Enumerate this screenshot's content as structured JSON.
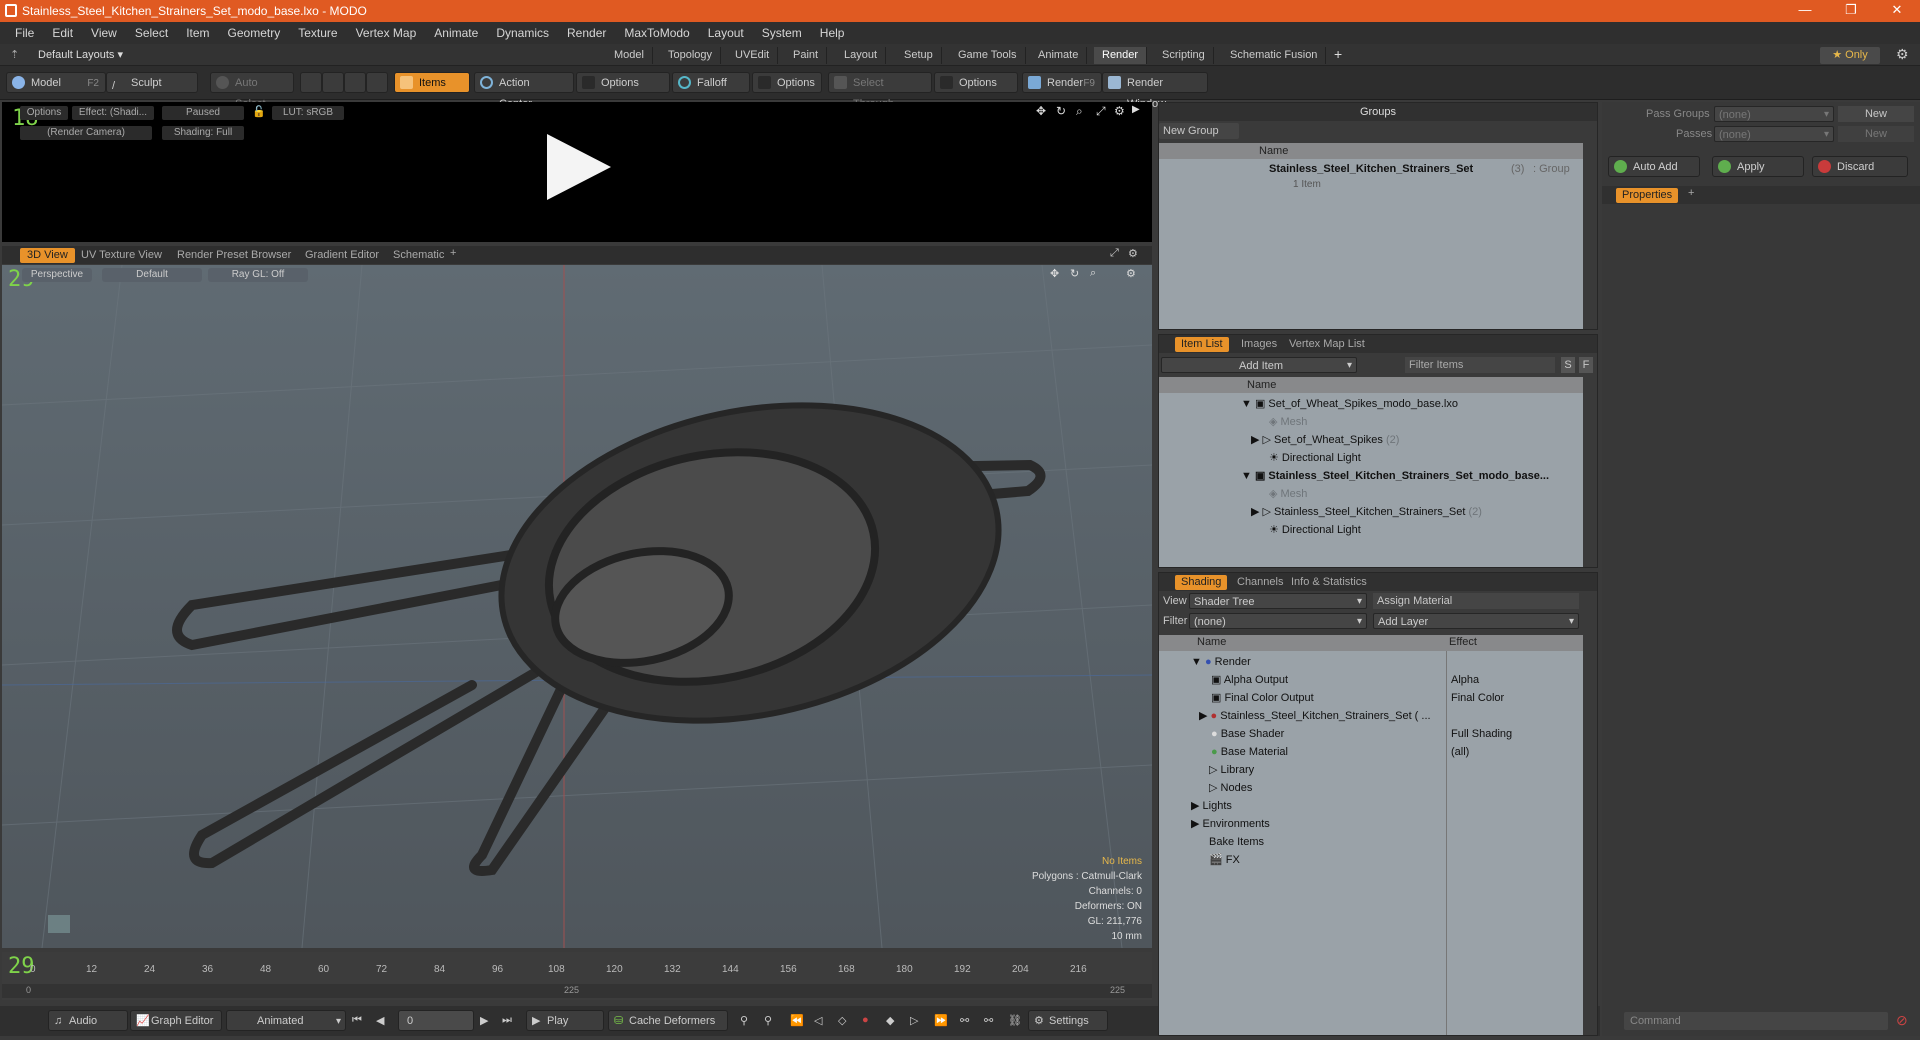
{
  "window": {
    "title": "Stainless_Steel_Kitchen_Strainers_Set_modo_base.lxo - MODO",
    "min": "—",
    "restore": "❐",
    "close": "✕"
  },
  "menu": [
    "File",
    "Edit",
    "View",
    "Select",
    "Item",
    "Geometry",
    "Texture",
    "Vertex Map",
    "Animate",
    "Dynamics",
    "Render",
    "MaxToModo",
    "Layout",
    "System",
    "Help"
  ],
  "layouts": {
    "label": "Default Layouts ▾",
    "tabs": [
      "Model",
      "Topology",
      "UVEdit",
      "Paint",
      "Layout",
      "Setup",
      "Game Tools",
      "Animate",
      "Render",
      "Scripting",
      "Schematic Fusion"
    ],
    "active": "Render",
    "plus": "+",
    "only": "★ Only"
  },
  "toolbar": {
    "model": "Model",
    "model_key": "F2",
    "sculpt": "Sculpt",
    "auto_select": "Auto Select",
    "items": "Items",
    "action_center": "Action Center",
    "options1": "Options",
    "falloff": "Falloff",
    "options2": "Options",
    "select_through": "Select Through",
    "options3": "Options",
    "render": "Render",
    "render_key": "F9",
    "render_window": "Render Window"
  },
  "render_preview": {
    "fps": "18",
    "options": "Options",
    "effect": "Effect: (Shadi...",
    "paused": "Paused",
    "lut": "LUT: sRGB",
    "camera": "(Render Camera)",
    "shading": "Shading: Full"
  },
  "view_tabs": [
    "3D View",
    "UV Texture View",
    "Render Preset Browser",
    "Gradient Editor",
    "Schematic"
  ],
  "viewport": {
    "fps": "29",
    "perspective": "Perspective",
    "default": "Default",
    "raygl": "Ray GL: Off",
    "stats": {
      "no_items": "No Items",
      "polygons": "Polygons : Catmull-Clark",
      "channels": "Channels: 0",
      "deformers": "Deformers: ON",
      "gl": "GL: 211,776",
      "unit": "10 mm"
    }
  },
  "timeline": {
    "fps": "29",
    "ticks": [
      "0",
      "12",
      "24",
      "36",
      "48",
      "60",
      "72",
      "84",
      "96",
      "108",
      "120",
      "132",
      "144",
      "156",
      "168",
      "180",
      "192",
      "204",
      "216"
    ],
    "start": "0",
    "mid": "225",
    "end": "225"
  },
  "bottom": {
    "audio": "Audio",
    "graph_editor": "Graph Editor",
    "animated": "Animated",
    "frame": "0",
    "play": "Play",
    "cache_deformers": "Cache Deformers",
    "settings": "Settings"
  },
  "groups": {
    "title": "Groups",
    "new_group": "New Group",
    "col_name": "Name",
    "item_name": "Stainless_Steel_Kitchen_Strainers_Set",
    "item_count": "(3)",
    "item_type": ": Group",
    "item_sub": "1 Item"
  },
  "item_list": {
    "tabs": [
      "Item List",
      "Images",
      "Vertex Map List"
    ],
    "add_item": "Add Item",
    "filter": "Filter Items",
    "s": "S",
    "f": "F",
    "col_name": "Name",
    "rows": [
      {
        "text": "Set_of_Wheat_Spikes_modo_base.lxo",
        "style": "",
        "indent": 0,
        "arrow": "▼"
      },
      {
        "text": "Mesh",
        "style": "gray",
        "indent": 2,
        "arrow": ""
      },
      {
        "text": "Set_of_Wheat_Spikes",
        "style": "",
        "indent": 1,
        "arrow": "▶",
        "count": "(2)"
      },
      {
        "text": "Directional Light",
        "style": "",
        "indent": 1,
        "arrow": ""
      },
      {
        "text": "Stainless_Steel_Kitchen_Strainers_Set_modo_base...",
        "style": "bold",
        "indent": 0,
        "arrow": "▼"
      },
      {
        "text": "Mesh",
        "style": "gray",
        "indent": 2,
        "arrow": ""
      },
      {
        "text": "Stainless_Steel_Kitchen_Strainers_Set",
        "style": "",
        "indent": 1,
        "arrow": "▶",
        "count": "(2)"
      },
      {
        "text": "Directional Light",
        "style": "",
        "indent": 1,
        "arrow": ""
      }
    ]
  },
  "shading": {
    "tabs": [
      "Shading",
      "Channels",
      "Info & Statistics"
    ],
    "view_label": "View",
    "view_value": "Shader Tree",
    "assign": "Assign Material",
    "filter_label": "Filter",
    "filter_value": "(none)",
    "add_layer": "Add Layer",
    "col_name": "Name",
    "col_effect": "Effect",
    "rows": [
      {
        "name": "Render",
        "effect": "",
        "indent": 0
      },
      {
        "name": "Alpha Output",
        "effect": "Alpha",
        "indent": 1
      },
      {
        "name": "Final Color Output",
        "effect": "Final Color",
        "indent": 1
      },
      {
        "name": "Stainless_Steel_Kitchen_Strainers_Set ( ...",
        "effect": "",
        "indent": 1
      },
      {
        "name": "Base Shader",
        "effect": "Full Shading",
        "indent": 1
      },
      {
        "name": "Base Material",
        "effect": "(all)",
        "indent": 1
      },
      {
        "name": "Library",
        "effect": "",
        "indent": 1
      },
      {
        "name": "Nodes",
        "effect": "",
        "indent": 1
      },
      {
        "name": "Lights",
        "effect": "",
        "indent": 0
      },
      {
        "name": "Environments",
        "effect": "",
        "indent": 0
      },
      {
        "name": "Bake Items",
        "effect": "",
        "indent": 0
      },
      {
        "name": "FX",
        "effect": "",
        "indent": 0
      }
    ]
  },
  "pass": {
    "pass_groups": "Pass Groups",
    "passes": "Passes",
    "none": "(none)",
    "new": "New",
    "auto_add": "Auto Add",
    "apply": "Apply",
    "discard": "Discard",
    "properties": "Properties",
    "command": "Command"
  }
}
